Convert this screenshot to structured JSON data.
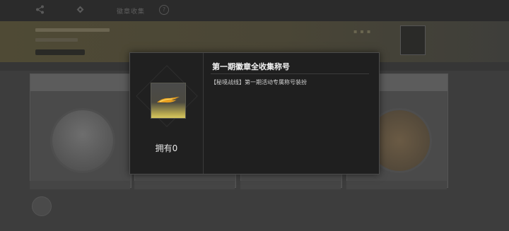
{
  "background": {
    "header_title": "徽章收集",
    "help_icon": "help-circle-icon",
    "share_icon": "share-icon",
    "settings_icon": "gear-icon"
  },
  "modal": {
    "item_title": "第一期徽章全收集称号",
    "item_description": "【秘境战线】第一期活动专属称号装扮",
    "owned_count": "拥有0",
    "item_icon": "golden-wing-title-icon"
  }
}
